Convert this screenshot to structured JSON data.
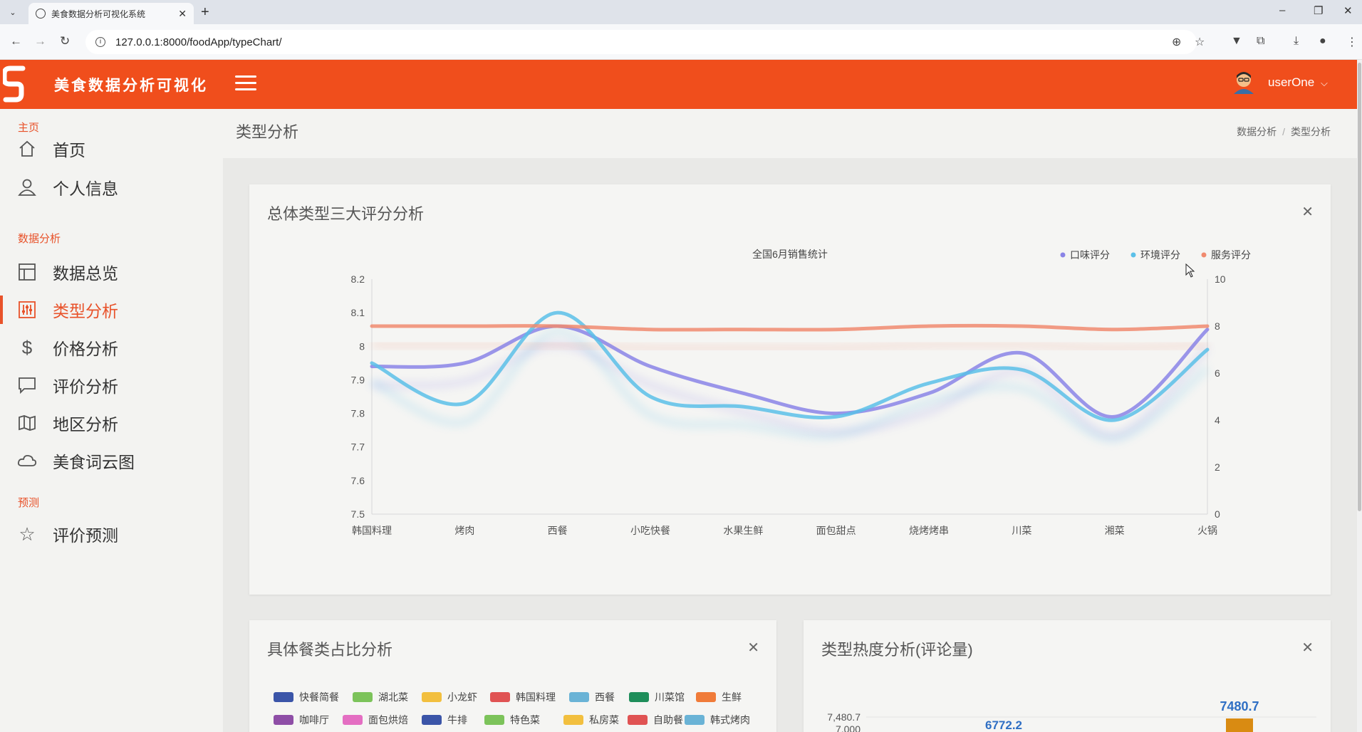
{
  "browser": {
    "tab_title": "美食数据分析可视化系统",
    "url": "127.0.0.1:8000/foodApp/typeChart/"
  },
  "header": {
    "brand": "美食数据分析可视化",
    "username": "userOne",
    "accent": "#f04e1c"
  },
  "sidebar": {
    "sections": [
      {
        "label": "主页",
        "items": [
          {
            "label": "首页",
            "icon": "home-icon"
          },
          {
            "label": "个人信息",
            "icon": "user-icon"
          }
        ]
      },
      {
        "label": "数据分析",
        "items": [
          {
            "label": "数据总览",
            "icon": "layout-icon"
          },
          {
            "label": "类型分析",
            "icon": "sliders-icon",
            "active": true
          },
          {
            "label": "价格分析",
            "icon": "dollar-icon"
          },
          {
            "label": "评价分析",
            "icon": "comment-icon"
          },
          {
            "label": "地区分析",
            "icon": "map-icon"
          },
          {
            "label": "美食词云图",
            "icon": "cloud-icon"
          }
        ]
      },
      {
        "label": "预测",
        "items": [
          {
            "label": "评价预测",
            "icon": "star-icon"
          }
        ]
      }
    ]
  },
  "page": {
    "title": "类型分析",
    "breadcrumb": [
      "数据分析",
      "类型分析"
    ]
  },
  "card1": {
    "title": "总体类型三大评分分析"
  },
  "card2": {
    "title": "具体餐类占比分析",
    "legend": [
      {
        "label": "快餐简餐",
        "color": "#3b55a8"
      },
      {
        "label": "湖北菜",
        "color": "#7cc35a"
      },
      {
        "label": "小龙虾",
        "color": "#f2bf3e"
      },
      {
        "label": "韩国料理",
        "color": "#e05353"
      },
      {
        "label": "西餐",
        "color": "#6ab3d6"
      },
      {
        "label": "川菜馆",
        "color": "#1e8e5a"
      },
      {
        "label": "生鲜",
        "color": "#f07b39"
      },
      {
        "label": "咖啡厅",
        "color": "#8e4ea6"
      },
      {
        "label": "面包烘焙",
        "color": "#e46ec2"
      },
      {
        "label": "牛排",
        "color": "#3b55a8"
      },
      {
        "label": "特色菜",
        "color": "#7cc35a"
      },
      {
        "label": "私房菜",
        "color": "#f2bf3e"
      },
      {
        "label": "自助餐",
        "color": "#e05353"
      },
      {
        "label": "韩式烤肉",
        "color": "#6ab3d6"
      }
    ]
  },
  "card3": {
    "title": "类型热度分析(评论量)",
    "y_top_label": "7,480.7",
    "y_second_label": "7,000",
    "bar_label_1": "6772.2",
    "bar_label_2": "7480.7"
  },
  "chart_data": [
    {
      "type": "line",
      "title": "全国6月销售统计",
      "categories": [
        "韩国料理",
        "烤肉",
        "西餐",
        "小吃快餐",
        "水果生鲜",
        "面包甜点",
        "烧烤烤串",
        "川菜",
        "湘菜",
        "火锅"
      ],
      "ylim": [
        7.5,
        8.2
      ],
      "yticks": [
        "8.2",
        "8.1",
        "8",
        "7.9",
        "7.8",
        "7.7",
        "7.6",
        "7.5"
      ],
      "y2lim": [
        0,
        10
      ],
      "y2ticks": [
        "10",
        "8",
        "6",
        "4",
        "2",
        "0"
      ],
      "legend_position": "top-right",
      "series": [
        {
          "name": "口味评分",
          "color": "#8a84e6",
          "values": [
            7.94,
            7.95,
            8.06,
            7.94,
            7.86,
            7.8,
            7.86,
            7.98,
            7.79,
            8.05
          ]
        },
        {
          "name": "环境评分",
          "color": "#5bc0e8",
          "values": [
            7.95,
            7.83,
            8.1,
            7.85,
            7.82,
            7.79,
            7.89,
            7.93,
            7.78,
            7.99
          ]
        },
        {
          "name": "服务评分",
          "color": "#f08a6e",
          "values": [
            8.06,
            8.06,
            8.06,
            8.05,
            8.05,
            8.05,
            8.06,
            8.06,
            8.05,
            8.06
          ]
        }
      ]
    },
    {
      "type": "bar",
      "values": [
        6772.2,
        7480.7
      ],
      "ylim": [
        null,
        7480.7
      ]
    }
  ]
}
